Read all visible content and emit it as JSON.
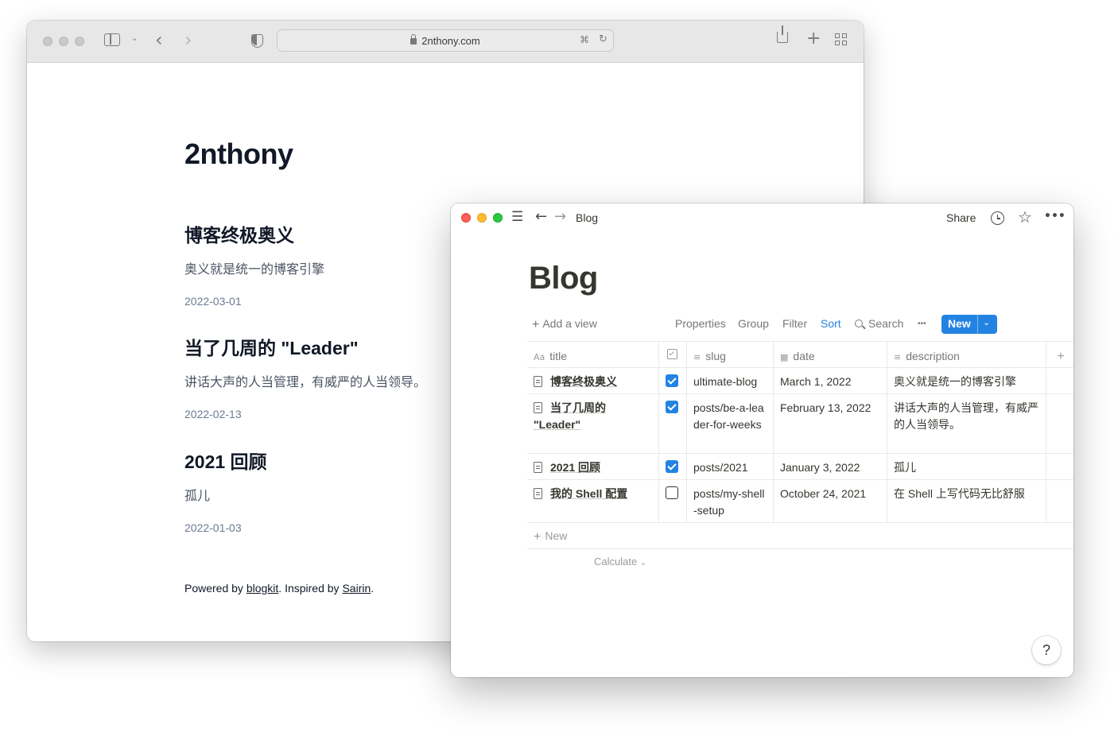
{
  "browser": {
    "url": "2nthony.com"
  },
  "blog_site": {
    "title": "2nthony",
    "posts": [
      {
        "title": "博客终极奥义",
        "description": "奥义就是统一的博客引擎",
        "date": "2022-03-01"
      },
      {
        "title": "当了几周的 \"Leader\"",
        "description": "讲话大声的人当管理，有威严的人当领导。",
        "date": "2022-02-13"
      },
      {
        "title": "2021 回顾",
        "description": "孤儿",
        "date": "2022-01-03"
      }
    ],
    "footer": {
      "prefix": "Powered by ",
      "link1": "blogkit",
      "middle": ". Inspired by ",
      "link2": "Sairin",
      "suffix": "."
    }
  },
  "notion": {
    "breadcrumb": "Blog",
    "share_label": "Share",
    "page_title": "Blog",
    "toolbar": {
      "add_view": "Add a view",
      "properties": "Properties",
      "group": "Group",
      "filter": "Filter",
      "sort": "Sort",
      "search": "Search",
      "more": "•••",
      "new": "New"
    },
    "columns": {
      "title": "title",
      "slug": "slug",
      "date": "date",
      "description": "description"
    },
    "rows": [
      {
        "title": "博客终极奥义",
        "checked": true,
        "slug": "ultimate-blog",
        "date": "March 1, 2022",
        "description": "奥义就是统一的博客引擎"
      },
      {
        "title": "当了几周的 \"Leader\"",
        "checked": true,
        "slug": "posts/be-a-leader-for-weeks",
        "date": "February 13, 2022",
        "description": "讲话大声的人当管理，有威严的人当领导。"
      },
      {
        "title": "2021 回顾",
        "checked": true,
        "slug": "posts/2021",
        "date": "January 3, 2022",
        "description": "孤儿"
      },
      {
        "title": "我的 Shell 配置",
        "checked": false,
        "slug": "posts/my-shell-setup",
        "date": "October 24, 2021",
        "description": "在 Shell 上写代码无比舒服"
      }
    ],
    "new_row_label": "New",
    "calculate_label": "Calculate",
    "help_label": "?",
    "colors": {
      "accent": "#2383e2",
      "text": "#37352f",
      "muted": "#787774"
    }
  }
}
